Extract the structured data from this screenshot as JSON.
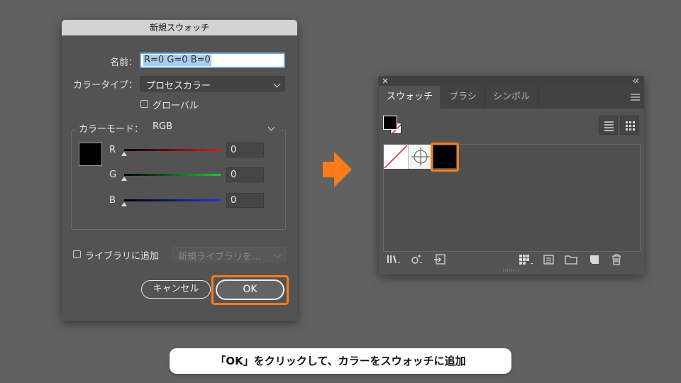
{
  "dialog": {
    "title": "新規スウォッチ",
    "name_label": "名前：",
    "name_value": "R=0 G=0 B=0",
    "color_type_label": "カラータイプ：",
    "color_type_value": "プロセスカラー",
    "global_label": "グローバル",
    "color_mode_label": "カラーモード：",
    "color_mode_value": "RGB",
    "sliders": [
      {
        "label": "R",
        "value": "0",
        "gradient_end": "#e0191c"
      },
      {
        "label": "G",
        "value": "0",
        "gradient_end": "#23c23a"
      },
      {
        "label": "B",
        "value": "0",
        "gradient_end": "#2230e0"
      }
    ],
    "add_to_library_label": "ライブラリに追加",
    "library_placeholder": "新規ライブラリを...",
    "cancel_label": "キャンセル",
    "ok_label": "OK",
    "swatch_color": "#000000"
  },
  "panel": {
    "tabs": [
      "スウォッチ",
      "ブラシ",
      "シンボル"
    ],
    "active_tab": 0,
    "swatches": [
      "none",
      "registration",
      "black"
    ],
    "footer_icons": [
      "library-menu-icon",
      "show-kind-menu-icon",
      "place-swatch-icon",
      "new-color-group-icon",
      "swatch-options-icon",
      "color-folder-icon",
      "new-swatch-icon",
      "delete-swatch-icon"
    ]
  },
  "accent_color": "#ff7a1a",
  "caption": "「OK」をクリックして、カラーをスウォッチに追加"
}
